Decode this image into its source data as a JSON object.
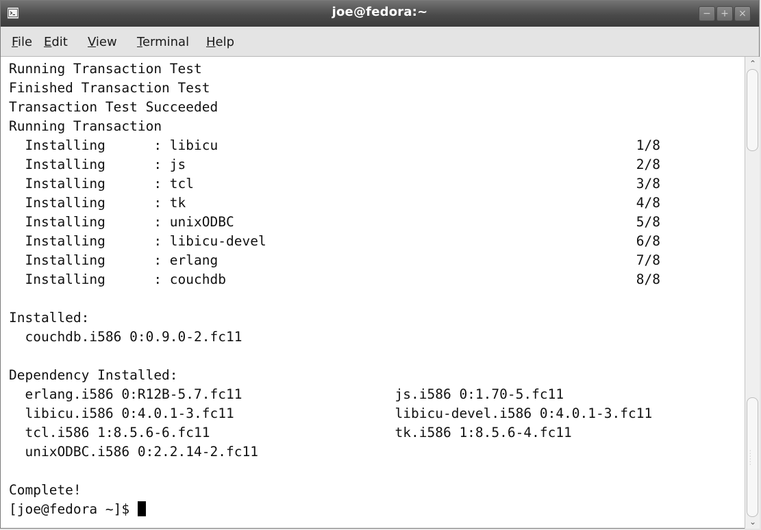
{
  "window": {
    "title": "joe@fedora:~",
    "controls": {
      "minimize": "−",
      "maximize": "+",
      "close": "×"
    }
  },
  "menubar": {
    "file": {
      "mnemonic": "F",
      "rest": "ile"
    },
    "edit": {
      "mnemonic": "E",
      "rest": "dit"
    },
    "view": {
      "mnemonic": "V",
      "rest": "iew"
    },
    "terminal": {
      "mnemonic": "T",
      "rest": "erminal"
    },
    "help": {
      "mnemonic": "H",
      "rest": "elp"
    }
  },
  "terminal": {
    "lines": [
      "Running Transaction Test",
      "Finished Transaction Test",
      "Transaction Test Succeeded",
      "Running Transaction",
      "  Installing      : libicu                                                    1/8",
      "  Installing      : js                                                        2/8",
      "  Installing      : tcl                                                       3/8",
      "  Installing      : tk                                                        4/8",
      "  Installing      : unixODBC                                                  5/8",
      "  Installing      : libicu-devel                                              6/8",
      "  Installing      : erlang                                                    7/8",
      "  Installing      : couchdb                                                   8/8",
      "",
      "Installed:",
      "  couchdb.i586 0:0.9.0-2.fc11",
      "",
      "Dependency Installed:",
      "  erlang.i586 0:R12B-5.7.fc11                   js.i586 0:1.70-5.fc11",
      "  libicu.i586 0:4.0.1-3.fc11                    libicu-devel.i586 0:4.0.1-3.fc11",
      "  tcl.i586 1:8.5.6-6.fc11                       tk.i586 1:8.5.6-4.fc11",
      "  unixODBC.i586 0:2.2.14-2.fc11",
      "",
      "Complete!"
    ],
    "prompt": "[joe@fedora ~]$ "
  },
  "icons": {
    "window_icon": "terminal-icon",
    "scroll_up": "arrow-up-icon",
    "scroll_down": "arrow-down-icon"
  }
}
